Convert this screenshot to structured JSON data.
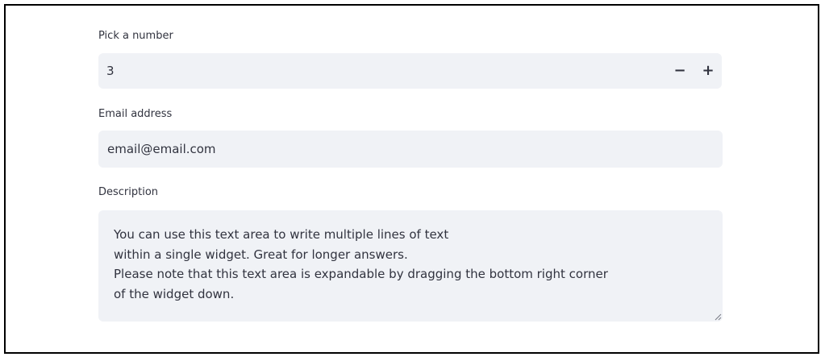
{
  "number_field": {
    "label": "Pick a number",
    "value": "3",
    "decrement_label": "−",
    "increment_label": "+"
  },
  "email_field": {
    "label": "Email address",
    "value": "email@email.com"
  },
  "description_field": {
    "label": "Description",
    "value": "You can use this text area to write multiple lines of text\nwithin a single widget. Great for longer answers.\nPlease note that this text area is expandable by dragging the bottom right corner\nof the widget down."
  },
  "colors": {
    "input_background": "#f0f2f6",
    "text": "#31333f",
    "frame_border": "#000000"
  }
}
